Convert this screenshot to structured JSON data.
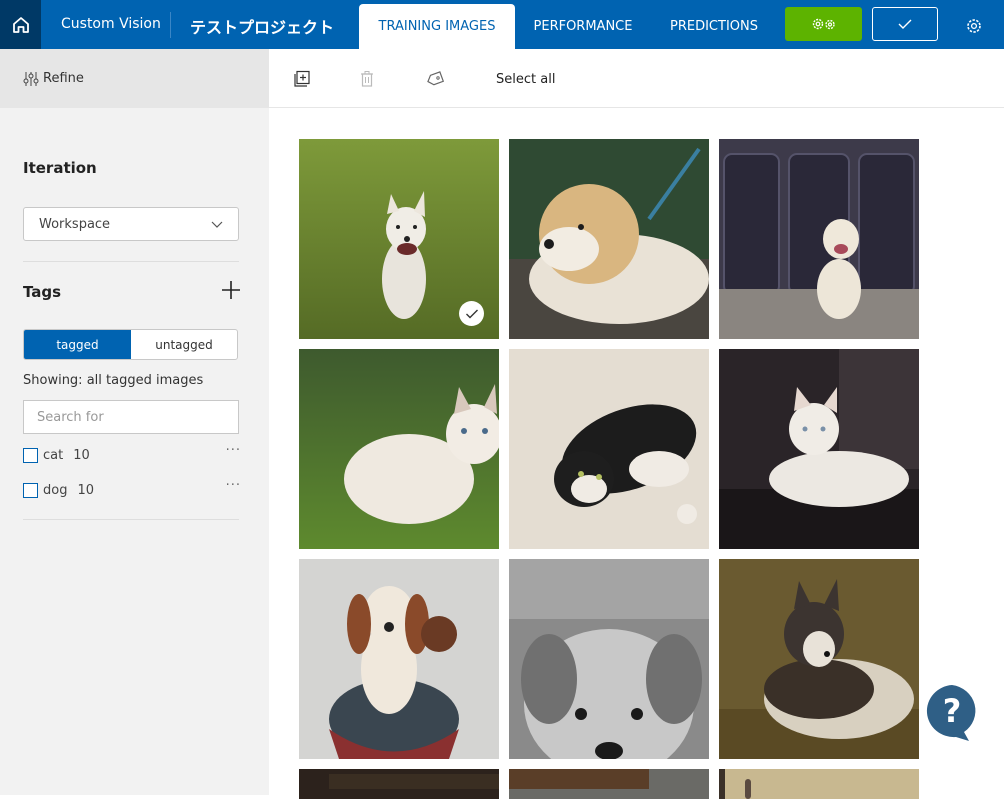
{
  "header": {
    "brand": "Custom Vision",
    "project": "テストプロジェクト",
    "tabs": [
      {
        "label": "TRAINING IMAGES",
        "active": true
      },
      {
        "label": "PERFORMANCE",
        "active": false
      },
      {
        "label": "PREDICTIONS",
        "active": false
      }
    ],
    "train_icon": "gears-icon",
    "quick_test_icon": "checkmark-icon",
    "settings_icon": "gear-icon",
    "colors": {
      "brand": "#0063b1",
      "train": "#5db300",
      "home_bg": "#003966"
    }
  },
  "sidebar": {
    "refine_label": "Refine",
    "iteration": {
      "title": "Iteration",
      "selected": "Workspace"
    },
    "tags": {
      "title": "Tags",
      "toggle": [
        "tagged",
        "untagged"
      ],
      "active_toggle": "tagged",
      "showing": "Showing: all tagged images",
      "search_placeholder": "Search for",
      "items": [
        {
          "name": "cat",
          "count": "10"
        },
        {
          "name": "dog",
          "count": "10"
        }
      ]
    }
  },
  "toolbar": {
    "add_images_icon": "add-images-icon",
    "delete_icon": "trash-icon",
    "tag_icon": "tag-icon",
    "select_all": "Select all"
  },
  "images": [
    {
      "subject": "white dog running on grass",
      "selected": true
    },
    {
      "subject": "fluffy puppy lying",
      "selected": false
    },
    {
      "subject": "labrador in front of tires",
      "selected": false
    },
    {
      "subject": "white kitten on grass",
      "selected": false
    },
    {
      "subject": "black and white cat lying on floor",
      "selected": false
    },
    {
      "subject": "white cat on sofa",
      "selected": false
    },
    {
      "subject": "dog figurine on cupcake",
      "selected": false
    },
    {
      "subject": "grayscale puppy face",
      "selected": false
    },
    {
      "subject": "malamute lying on grass",
      "selected": false
    },
    {
      "subject": "dark indoor image",
      "selected": false
    },
    {
      "subject": "brown cabinet image",
      "selected": false
    },
    {
      "subject": "beige outdoor image",
      "selected": false
    }
  ],
  "help_icon": "help-chat-icon"
}
